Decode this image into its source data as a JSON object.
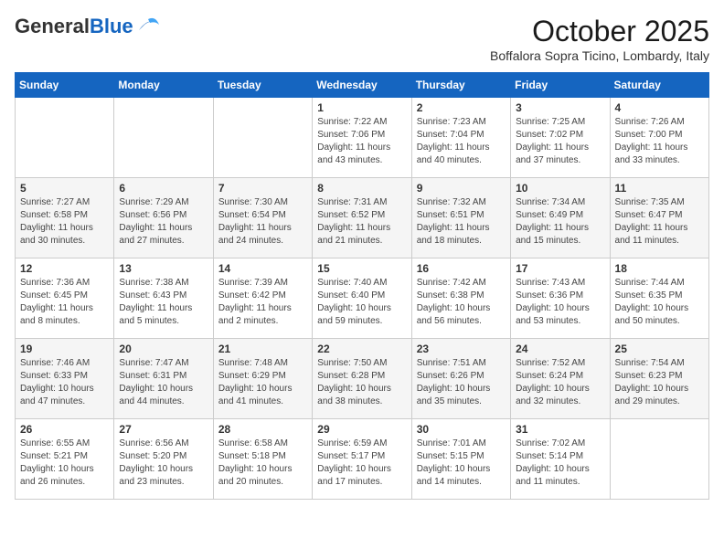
{
  "header": {
    "logo_general": "General",
    "logo_blue": "Blue",
    "month": "October 2025",
    "location": "Boffalora Sopra Ticino, Lombardy, Italy"
  },
  "days_of_week": [
    "Sunday",
    "Monday",
    "Tuesday",
    "Wednesday",
    "Thursday",
    "Friday",
    "Saturday"
  ],
  "weeks": [
    [
      {
        "day": "",
        "info": ""
      },
      {
        "day": "",
        "info": ""
      },
      {
        "day": "",
        "info": ""
      },
      {
        "day": "1",
        "info": "Sunrise: 7:22 AM\nSunset: 7:06 PM\nDaylight: 11 hours\nand 43 minutes."
      },
      {
        "day": "2",
        "info": "Sunrise: 7:23 AM\nSunset: 7:04 PM\nDaylight: 11 hours\nand 40 minutes."
      },
      {
        "day": "3",
        "info": "Sunrise: 7:25 AM\nSunset: 7:02 PM\nDaylight: 11 hours\nand 37 minutes."
      },
      {
        "day": "4",
        "info": "Sunrise: 7:26 AM\nSunset: 7:00 PM\nDaylight: 11 hours\nand 33 minutes."
      }
    ],
    [
      {
        "day": "5",
        "info": "Sunrise: 7:27 AM\nSunset: 6:58 PM\nDaylight: 11 hours\nand 30 minutes."
      },
      {
        "day": "6",
        "info": "Sunrise: 7:29 AM\nSunset: 6:56 PM\nDaylight: 11 hours\nand 27 minutes."
      },
      {
        "day": "7",
        "info": "Sunrise: 7:30 AM\nSunset: 6:54 PM\nDaylight: 11 hours\nand 24 minutes."
      },
      {
        "day": "8",
        "info": "Sunrise: 7:31 AM\nSunset: 6:52 PM\nDaylight: 11 hours\nand 21 minutes."
      },
      {
        "day": "9",
        "info": "Sunrise: 7:32 AM\nSunset: 6:51 PM\nDaylight: 11 hours\nand 18 minutes."
      },
      {
        "day": "10",
        "info": "Sunrise: 7:34 AM\nSunset: 6:49 PM\nDaylight: 11 hours\nand 15 minutes."
      },
      {
        "day": "11",
        "info": "Sunrise: 7:35 AM\nSunset: 6:47 PM\nDaylight: 11 hours\nand 11 minutes."
      }
    ],
    [
      {
        "day": "12",
        "info": "Sunrise: 7:36 AM\nSunset: 6:45 PM\nDaylight: 11 hours\nand 8 minutes."
      },
      {
        "day": "13",
        "info": "Sunrise: 7:38 AM\nSunset: 6:43 PM\nDaylight: 11 hours\nand 5 minutes."
      },
      {
        "day": "14",
        "info": "Sunrise: 7:39 AM\nSunset: 6:42 PM\nDaylight: 11 hours\nand 2 minutes."
      },
      {
        "day": "15",
        "info": "Sunrise: 7:40 AM\nSunset: 6:40 PM\nDaylight: 10 hours\nand 59 minutes."
      },
      {
        "day": "16",
        "info": "Sunrise: 7:42 AM\nSunset: 6:38 PM\nDaylight: 10 hours\nand 56 minutes."
      },
      {
        "day": "17",
        "info": "Sunrise: 7:43 AM\nSunset: 6:36 PM\nDaylight: 10 hours\nand 53 minutes."
      },
      {
        "day": "18",
        "info": "Sunrise: 7:44 AM\nSunset: 6:35 PM\nDaylight: 10 hours\nand 50 minutes."
      }
    ],
    [
      {
        "day": "19",
        "info": "Sunrise: 7:46 AM\nSunset: 6:33 PM\nDaylight: 10 hours\nand 47 minutes."
      },
      {
        "day": "20",
        "info": "Sunrise: 7:47 AM\nSunset: 6:31 PM\nDaylight: 10 hours\nand 44 minutes."
      },
      {
        "day": "21",
        "info": "Sunrise: 7:48 AM\nSunset: 6:29 PM\nDaylight: 10 hours\nand 41 minutes."
      },
      {
        "day": "22",
        "info": "Sunrise: 7:50 AM\nSunset: 6:28 PM\nDaylight: 10 hours\nand 38 minutes."
      },
      {
        "day": "23",
        "info": "Sunrise: 7:51 AM\nSunset: 6:26 PM\nDaylight: 10 hours\nand 35 minutes."
      },
      {
        "day": "24",
        "info": "Sunrise: 7:52 AM\nSunset: 6:24 PM\nDaylight: 10 hours\nand 32 minutes."
      },
      {
        "day": "25",
        "info": "Sunrise: 7:54 AM\nSunset: 6:23 PM\nDaylight: 10 hours\nand 29 minutes."
      }
    ],
    [
      {
        "day": "26",
        "info": "Sunrise: 6:55 AM\nSunset: 5:21 PM\nDaylight: 10 hours\nand 26 minutes."
      },
      {
        "day": "27",
        "info": "Sunrise: 6:56 AM\nSunset: 5:20 PM\nDaylight: 10 hours\nand 23 minutes."
      },
      {
        "day": "28",
        "info": "Sunrise: 6:58 AM\nSunset: 5:18 PM\nDaylight: 10 hours\nand 20 minutes."
      },
      {
        "day": "29",
        "info": "Sunrise: 6:59 AM\nSunset: 5:17 PM\nDaylight: 10 hours\nand 17 minutes."
      },
      {
        "day": "30",
        "info": "Sunrise: 7:01 AM\nSunset: 5:15 PM\nDaylight: 10 hours\nand 14 minutes."
      },
      {
        "day": "31",
        "info": "Sunrise: 7:02 AM\nSunset: 5:14 PM\nDaylight: 10 hours\nand 11 minutes."
      },
      {
        "day": "",
        "info": ""
      }
    ]
  ]
}
